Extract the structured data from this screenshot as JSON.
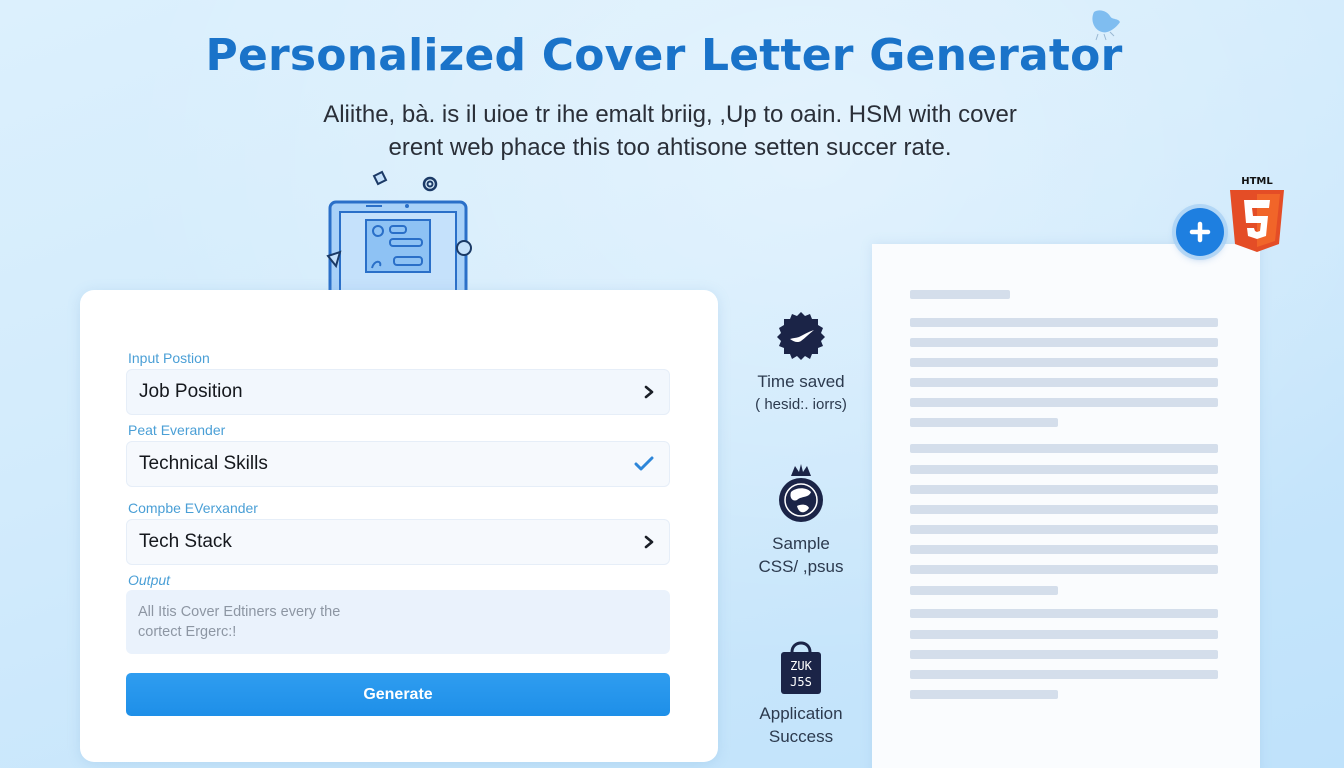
{
  "header": {
    "title": "Personalized Cover Letter Generator",
    "subtitle_line1": "Aliithe, bà. is il uioe tr ihe emalt briig, ,Up to oain. HSM with cover",
    "subtitle_line2": "erent web phace this too ahtisone setten succer rate."
  },
  "form": {
    "fields": [
      {
        "label": "Input Postion",
        "value": "Job Position",
        "indicator": "chevron-right"
      },
      {
        "label": "Peat Everander",
        "value": "Technical Skills",
        "indicator": "check"
      },
      {
        "label": "Compbe EVerxander",
        "value": "Tech Stack",
        "indicator": "chevron-right"
      }
    ],
    "output": {
      "label": "Output",
      "placeholder_line1": "All Itis Cover Edtiners every the",
      "placeholder_line2": "cortect Ergerc:!"
    },
    "generate_label": "Generate"
  },
  "stats": [
    {
      "icon": "checkmark-badge-icon",
      "line1": "Time saved",
      "line2": "( hesid:. iorrs)"
    },
    {
      "icon": "globe-crown-icon",
      "line1": "Sample",
      "line2": "CSS/ ,psus"
    },
    {
      "icon": "shopping-bag-icon",
      "line1": "Application",
      "line2": "Success",
      "badge_text_1": "ZUK",
      "badge_text_2": "J5S"
    }
  ],
  "preview": {
    "html5_label": "HTML",
    "html5_digit": "5"
  },
  "colors": {
    "title": "#1a73c9",
    "accent": "#1e8fe8",
    "label": "#4a9fd6",
    "html5_orange": "#e44d26",
    "icon_dark": "#1b2447"
  }
}
